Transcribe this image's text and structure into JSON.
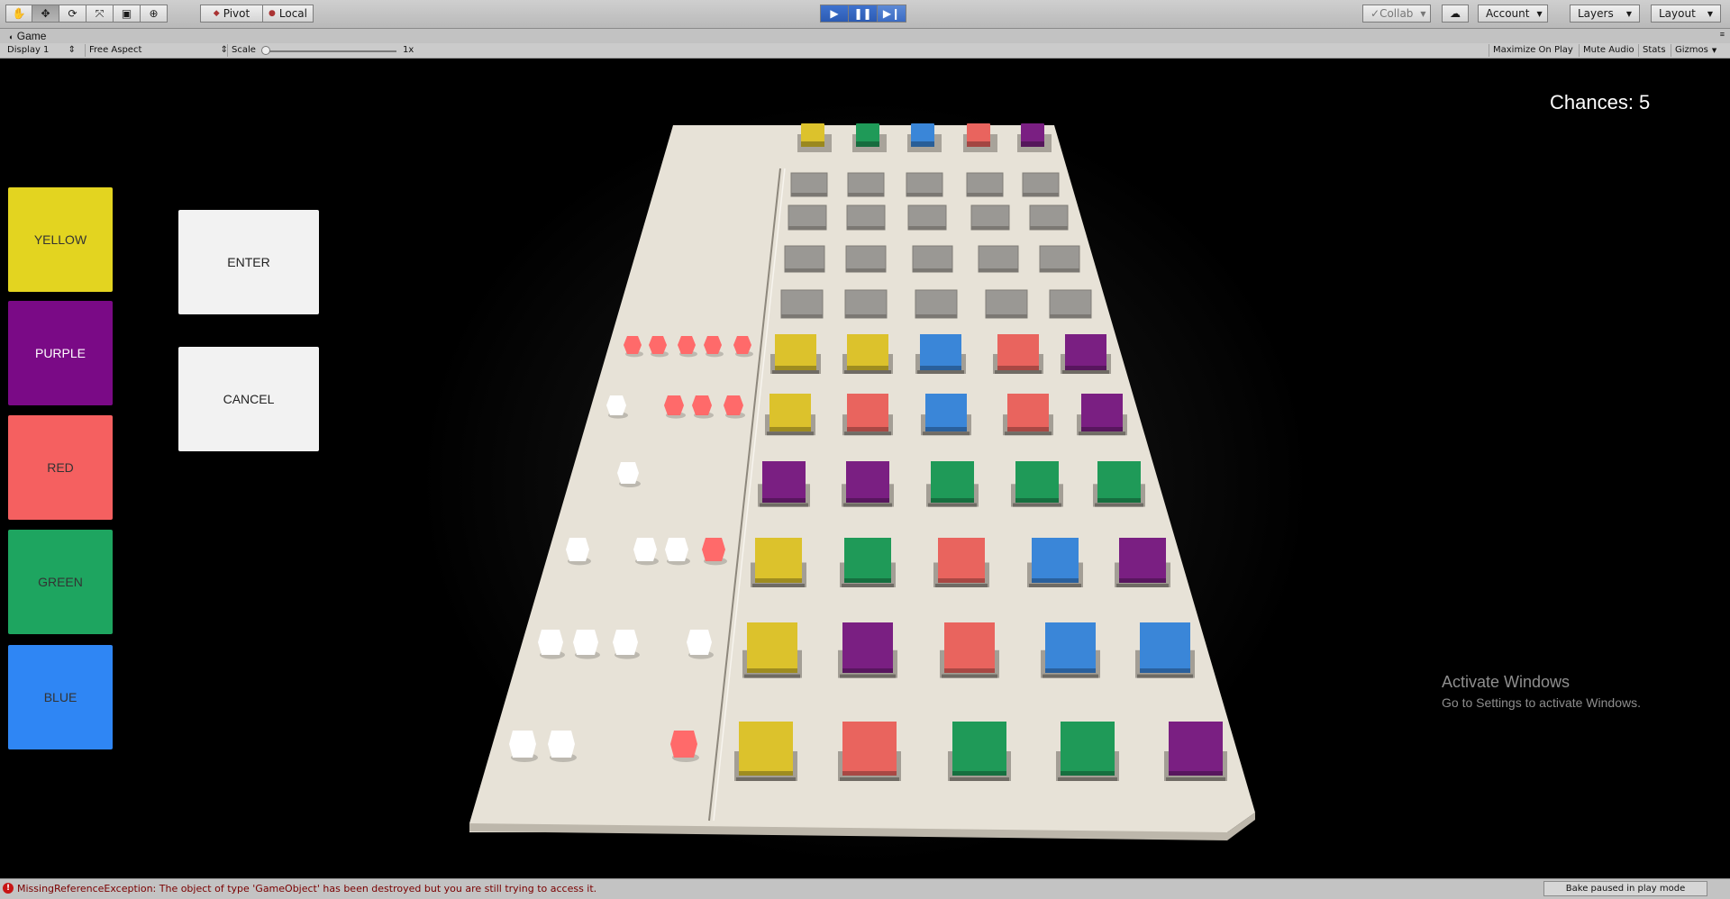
{
  "toolbar": {
    "tools": [
      "hand-tool",
      "move-tool",
      "rotate-tool",
      "scale-tool",
      "rect-tool",
      "transform-tool"
    ],
    "pivot_label": "Pivot",
    "local_label": "Local",
    "collab_label": "Collab",
    "account_label": "Account",
    "layers_label": "Layers",
    "layout_label": "Layout"
  },
  "tab": {
    "title": "Game"
  },
  "gamebar": {
    "display": "Display 1",
    "aspect": "Free Aspect",
    "scale_label": "Scale",
    "scale_value": "1x",
    "maximize": "Maximize On Play",
    "mute": "Mute Audio",
    "stats": "Stats",
    "gizmos": "Gizmos"
  },
  "game": {
    "chances": "Chances: 5",
    "color_buttons": [
      {
        "label": "YELLOW",
        "bg": "#e3d420",
        "fg": "#333333"
      },
      {
        "label": "PURPLE",
        "bg": "#7a0a86",
        "fg": "#ffffff"
      },
      {
        "label": "RED",
        "bg": "#f56060",
        "fg": "#333333"
      },
      {
        "label": "GREEN",
        "bg": "#1ea560",
        "fg": "#333333"
      },
      {
        "label": "BLUE",
        "bg": "#2f86f4",
        "fg": "#333333"
      }
    ],
    "enter_label": "ENTER",
    "cancel_label": "CANCEL",
    "secret_row": [
      "yellow",
      "green",
      "blue",
      "red",
      "purple"
    ],
    "guess_rows": [
      [
        "grey",
        "grey",
        "grey",
        "grey",
        "grey"
      ],
      [
        "grey",
        "grey",
        "grey",
        "grey",
        "grey"
      ],
      [
        "grey",
        "grey",
        "grey",
        "grey",
        "grey"
      ],
      [
        "grey",
        "grey",
        "grey",
        "grey",
        "grey"
      ],
      [
        "yellow",
        "yellow",
        "blue",
        "red",
        "purple"
      ],
      [
        "yellow",
        "red",
        "blue",
        "red",
        "purple"
      ],
      [
        "purple",
        "purple",
        "green",
        "green",
        "green"
      ],
      [
        "yellow",
        "green",
        "red",
        "blue",
        "purple"
      ],
      [
        "yellow",
        "purple",
        "red",
        "blue",
        "blue"
      ],
      [
        "yellow",
        "red",
        "green",
        "green",
        "purple"
      ]
    ],
    "feedback_rows": [
      [
        "red",
        "red",
        "red",
        "red",
        "red"
      ],
      [
        "white",
        "red",
        "red",
        "red"
      ],
      [
        "white"
      ],
      [
        "white",
        "white",
        "white",
        "red"
      ],
      [
        "white",
        "white",
        "white",
        "white"
      ],
      [
        "white",
        "white",
        "red"
      ]
    ],
    "palette": {
      "yellow": "#dcc22c",
      "green": "#1f9a58",
      "blue": "#3a86d8",
      "red": "#e9645e",
      "purple": "#7a1f82",
      "grey": "#9a9894",
      "white": "#ffffff",
      "peg_red": "#ff6a6a",
      "board": "#e7e2d7"
    }
  },
  "watermark": {
    "line1": "Activate Windows",
    "line2": "Go to Settings to activate Windows."
  },
  "status": {
    "error": "MissingReferenceException: The object of type 'GameObject' has been destroyed but you are still trying to access it.",
    "bake": "Bake paused in play mode"
  }
}
